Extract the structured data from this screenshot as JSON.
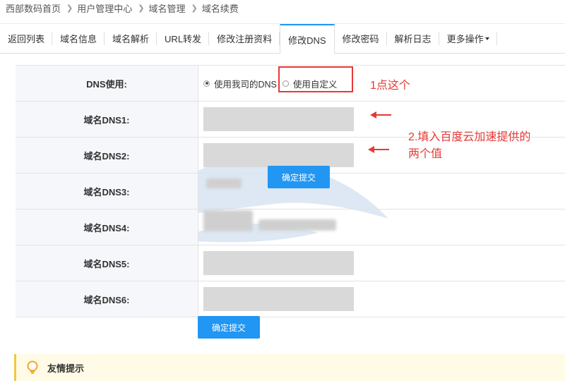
{
  "breadcrumb": [
    "西部数码首页",
    "用户管理中心",
    "域名管理",
    "域名续费"
  ],
  "tabs": [
    {
      "label": "返回列表"
    },
    {
      "label": "域名信息"
    },
    {
      "label": "域名解析"
    },
    {
      "label": "URL转发"
    },
    {
      "label": "修改注册资料"
    },
    {
      "label": "修改DNS",
      "active": true
    },
    {
      "label": "修改密码"
    },
    {
      "label": "解析日志"
    },
    {
      "label": "更多操作"
    }
  ],
  "form": {
    "dns_use_label": "DNS使用:",
    "option_ours": "使用我司的DNS",
    "option_custom": "使用自定义",
    "selected_option": "option_ours",
    "rows": [
      "域名DNS1:",
      "域名DNS2:",
      "域名DNS3:",
      "域名DNS4:",
      "域名DNS5:",
      "域名DNS6:"
    ],
    "submit_label": "确定提交",
    "submit_label_floating": "确定提交"
  },
  "annotations": {
    "step1": "1点这个",
    "step2_line1": "2.填入百度云加速提供的",
    "step2_line2": "两个值"
  },
  "tip": {
    "title": "友情提示"
  },
  "colors": {
    "accent": "#2196f3",
    "annotation": "#e53935",
    "tip_bg": "#fffbe6",
    "tip_border": "#f5c542"
  }
}
